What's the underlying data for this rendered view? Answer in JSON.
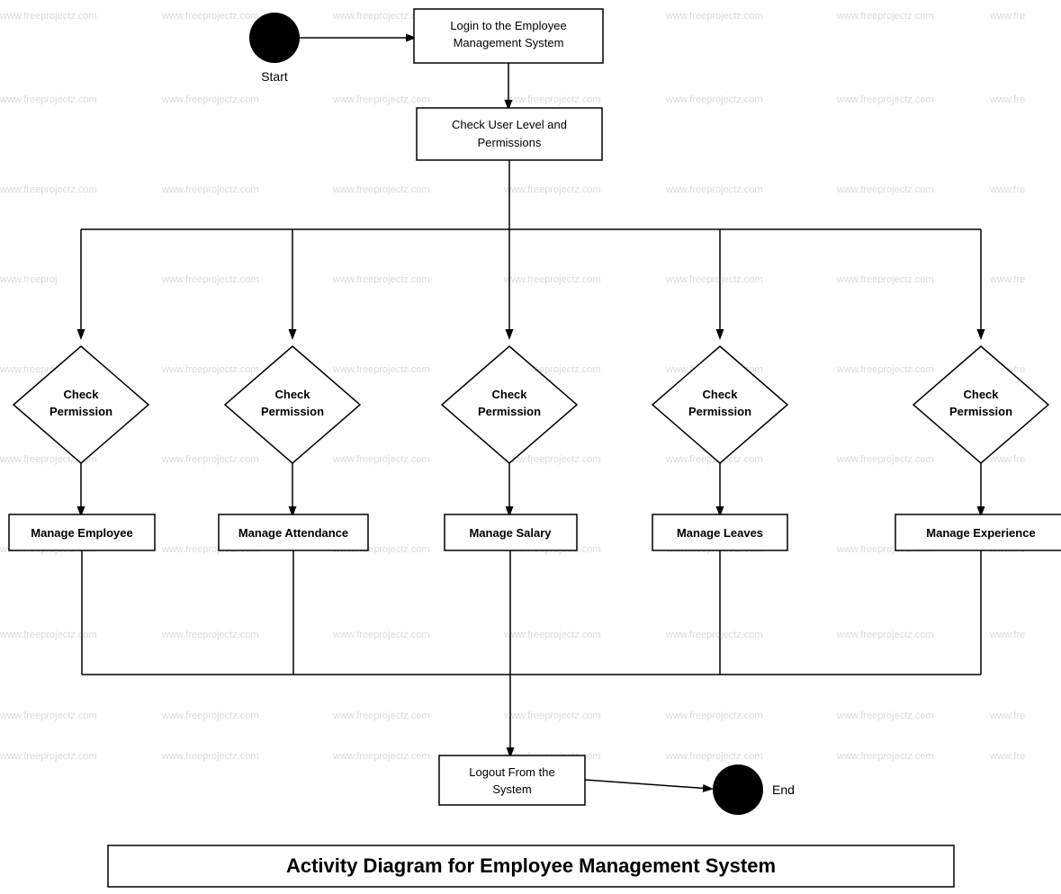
{
  "title": "Activity Diagram for Employee Management System",
  "watermark_text": "www.freeprojectz.com",
  "nodes": {
    "start_label": "Start",
    "end_label": "End",
    "login": "Login to the Employee Management System",
    "check_permissions": "Check User Level and Permissions",
    "check_permission_1": "Check\nPermission",
    "check_permission_2": "Check\nPermission",
    "check_permission_3": "Check\nPermission",
    "check_permission_4": "Check\nPermission",
    "check_permission_5": "Check\nPermission",
    "manage_employee": "Manage Employee",
    "manage_attendance": "Manage Attendance",
    "manage_salary": "Manage Salary",
    "manage_leaves": "Manage Leaves",
    "manage_experience": "Manage Experience",
    "logout": "Logout From the System"
  }
}
